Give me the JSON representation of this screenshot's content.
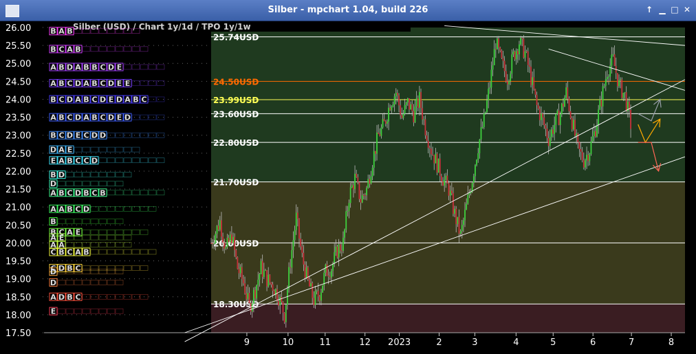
{
  "window": {
    "title": "Silber - mpchart 1.04, build 226",
    "buttons": [
      {
        "name": "up-arrow-button",
        "symbol": "↑"
      },
      {
        "name": "minimize-button",
        "symbol": "▁"
      },
      {
        "name": "maximize-button",
        "symbol": "□"
      },
      {
        "name": "close-button",
        "symbol": "✕"
      }
    ]
  },
  "chart_data": {
    "type": "line",
    "title": "Silber (USD) /  Chart 1y/1d / TPO 1y/1w",
    "y_ticks": [
      "26.00",
      "25.50",
      "25.00",
      "24.50",
      "24.00",
      "23.50",
      "23.00",
      "22.50",
      "22.00",
      "21.50",
      "21.00",
      "20.50",
      "20.00",
      "19.50",
      "19.00",
      "18.50",
      "18.00",
      "17.50"
    ],
    "ylim": [
      17.5,
      26.0
    ],
    "x_ticks": [
      "9",
      "10",
      "11",
      "12",
      "2023",
      "2",
      "3",
      "4",
      "5",
      "6",
      "7",
      "8"
    ],
    "zones": [
      {
        "from": 21.7,
        "to": 26.0,
        "color": "#1f3a1f"
      },
      {
        "from": 18.3,
        "to": 21.7,
        "color": "#3a3a1c"
      },
      {
        "from": 17.5,
        "to": 18.3,
        "color": "#3a1d22"
      }
    ],
    "levels": [
      {
        "value": 25.74,
        "label": "25.74USD",
        "color": "#ffffff"
      },
      {
        "value": 24.5,
        "label": "24.50USD",
        "color": "#ff6a00"
      },
      {
        "value": 23.99,
        "label": "23.99USD",
        "color": "#ffff55"
      },
      {
        "value": 23.6,
        "label": "23.60USD",
        "color": "#ffffff"
      },
      {
        "value": 22.8,
        "label": "22.80USD",
        "color": "#ffffff"
      },
      {
        "value": 21.7,
        "label": "21.70USD",
        "color": "#ffffff"
      },
      {
        "value": 20.0,
        "label": "20.00USD",
        "color": "#ffffff"
      },
      {
        "value": 18.3,
        "label": "18.30USD",
        "color": "#ffffff"
      }
    ],
    "price_keypoints": [
      [
        0,
        20.0
      ],
      [
        6,
        20.6
      ],
      [
        10,
        19.8
      ],
      [
        14,
        20.2
      ],
      [
        18,
        19.3
      ],
      [
        22,
        18.9
      ],
      [
        26,
        18.2
      ],
      [
        30,
        18.7
      ],
      [
        34,
        19.3
      ],
      [
        38,
        19.0
      ],
      [
        42,
        18.8
      ],
      [
        46,
        18.5
      ],
      [
        50,
        18.0
      ],
      [
        54,
        19.5
      ],
      [
        58,
        20.7
      ],
      [
        62,
        19.6
      ],
      [
        66,
        18.9
      ],
      [
        70,
        18.4
      ],
      [
        74,
        18.6
      ],
      [
        78,
        19.2
      ],
      [
        82,
        19.3
      ],
      [
        86,
        19.8
      ],
      [
        90,
        20.0
      ],
      [
        94,
        21.3
      ],
      [
        98,
        21.8
      ],
      [
        102,
        21.2
      ],
      [
        106,
        21.5
      ],
      [
        110,
        22.3
      ],
      [
        114,
        23.0
      ],
      [
        118,
        23.3
      ],
      [
        122,
        23.9
      ],
      [
        126,
        24.2
      ],
      [
        130,
        23.5
      ],
      [
        134,
        23.9
      ],
      [
        138,
        23.6
      ],
      [
        142,
        24.0
      ],
      [
        146,
        23.2
      ],
      [
        150,
        22.6
      ],
      [
        154,
        22.2
      ],
      [
        158,
        21.8
      ],
      [
        162,
        21.5
      ],
      [
        166,
        20.8
      ],
      [
        170,
        20.2
      ],
      [
        174,
        21.0
      ],
      [
        178,
        21.8
      ],
      [
        182,
        22.7
      ],
      [
        186,
        23.4
      ],
      [
        190,
        24.4
      ],
      [
        194,
        25.6
      ],
      [
        198,
        25.0
      ],
      [
        202,
        24.6
      ],
      [
        206,
        25.2
      ],
      [
        210,
        25.6
      ],
      [
        214,
        25.3
      ],
      [
        218,
        24.6
      ],
      [
        222,
        23.8
      ],
      [
        226,
        23.4
      ],
      [
        230,
        22.9
      ],
      [
        234,
        23.3
      ],
      [
        238,
        23.6
      ],
      [
        242,
        24.2
      ],
      [
        246,
        23.4
      ],
      [
        250,
        22.6
      ],
      [
        254,
        22.3
      ],
      [
        258,
        22.6
      ],
      [
        262,
        23.2
      ],
      [
        266,
        24.0
      ],
      [
        270,
        24.8
      ],
      [
        274,
        25.1
      ],
      [
        278,
        24.4
      ],
      [
        282,
        24.1
      ],
      [
        286,
        23.3
      ]
    ],
    "trendlines": [
      {
        "p1": [
          -18,
          17.25
        ],
        "p2": [
          323,
          24.55
        ],
        "color": "#ffffff"
      },
      {
        "p1": [
          -18,
          17.5
        ],
        "p2": [
          323,
          22.4
        ],
        "color": "#ffffff"
      },
      {
        "p1": [
          159,
          26.05
        ],
        "p2": [
          323,
          25.5
        ],
        "color": "#ffffff"
      },
      {
        "p1": [
          230,
          25.4
        ],
        "p2": [
          323,
          24.25
        ],
        "color": "#ffffff"
      }
    ],
    "scenario_arrows": [
      {
        "points": [
          [
            291,
            23.6
          ],
          [
            300,
            23.4
          ],
          [
            306,
            24.0
          ]
        ],
        "color": "#9aa0aa"
      },
      {
        "points": [
          [
            291,
            23.3
          ],
          [
            296,
            22.8
          ],
          [
            306,
            23.45
          ]
        ],
        "color": "#ffaa00"
      },
      {
        "points": [
          [
            291,
            22.8
          ],
          [
            300,
            22.8
          ],
          [
            305,
            22.0
          ]
        ],
        "color": "#ff6655"
      }
    ],
    "tpo_profile": [
      {
        "price": 25.9,
        "letters": [
          "B",
          "A",
          "B"
        ]
      },
      {
        "price": 25.4,
        "letters": [
          "B",
          "C",
          "A",
          "B"
        ]
      },
      {
        "price": 24.9,
        "letters": [
          "A",
          "B",
          "D",
          "A",
          "B",
          "B",
          "C",
          "D",
          "E"
        ]
      },
      {
        "price": 24.45,
        "letters": [
          "A",
          "B",
          "C",
          "D",
          "A",
          "B",
          "C",
          "D",
          "E",
          "E"
        ]
      },
      {
        "price": 24.0,
        "letters": [
          "B",
          "C",
          "D",
          "A",
          "B",
          "C",
          "D",
          "E",
          "D",
          "A",
          "B",
          "C"
        ]
      },
      {
        "price": 23.5,
        "letters": [
          "A",
          "B",
          "C",
          "D",
          "A",
          "B",
          "C",
          "D",
          "E",
          "D"
        ]
      },
      {
        "price": 23.0,
        "letters": [
          "B",
          "C",
          "D",
          "E",
          "C",
          "D",
          "D"
        ]
      },
      {
        "price": 22.6,
        "letters": [
          "D",
          "A",
          "E"
        ]
      },
      {
        "price": 22.3,
        "letters": [
          "E",
          "A",
          "B",
          "C",
          "C",
          "D"
        ]
      },
      {
        "price": 21.9,
        "letters": [
          "B",
          "D"
        ]
      },
      {
        "price": 21.65,
        "letters": [
          "D"
        ]
      },
      {
        "price": 21.4,
        "letters": [
          "A",
          "B",
          "C",
          "D",
          "B",
          "C",
          "B"
        ]
      },
      {
        "price": 20.95,
        "letters": [
          "A",
          "A",
          "B",
          "C",
          "D"
        ]
      },
      {
        "price": 20.6,
        "letters": [
          "B"
        ]
      },
      {
        "price": 20.3,
        "letters": [
          "B",
          "C",
          "A",
          "E"
        ]
      },
      {
        "price": 20.15,
        "letters": [
          "A",
          "E"
        ]
      },
      {
        "price": 19.95,
        "letters": [
          "A",
          "A"
        ]
      },
      {
        "price": 19.75,
        "letters": [
          "C",
          "B",
          "C",
          "A",
          "B"
        ]
      },
      {
        "price": 19.3,
        "letters": [
          "C",
          "D",
          "B",
          "C"
        ]
      },
      {
        "price": 19.2,
        "letters": [
          "D"
        ]
      },
      {
        "price": 18.9,
        "letters": [
          "D"
        ]
      },
      {
        "price": 18.5,
        "letters": [
          "A",
          "D",
          "B",
          "C"
        ]
      },
      {
        "price": 18.1,
        "letters": [
          "E"
        ]
      }
    ]
  }
}
